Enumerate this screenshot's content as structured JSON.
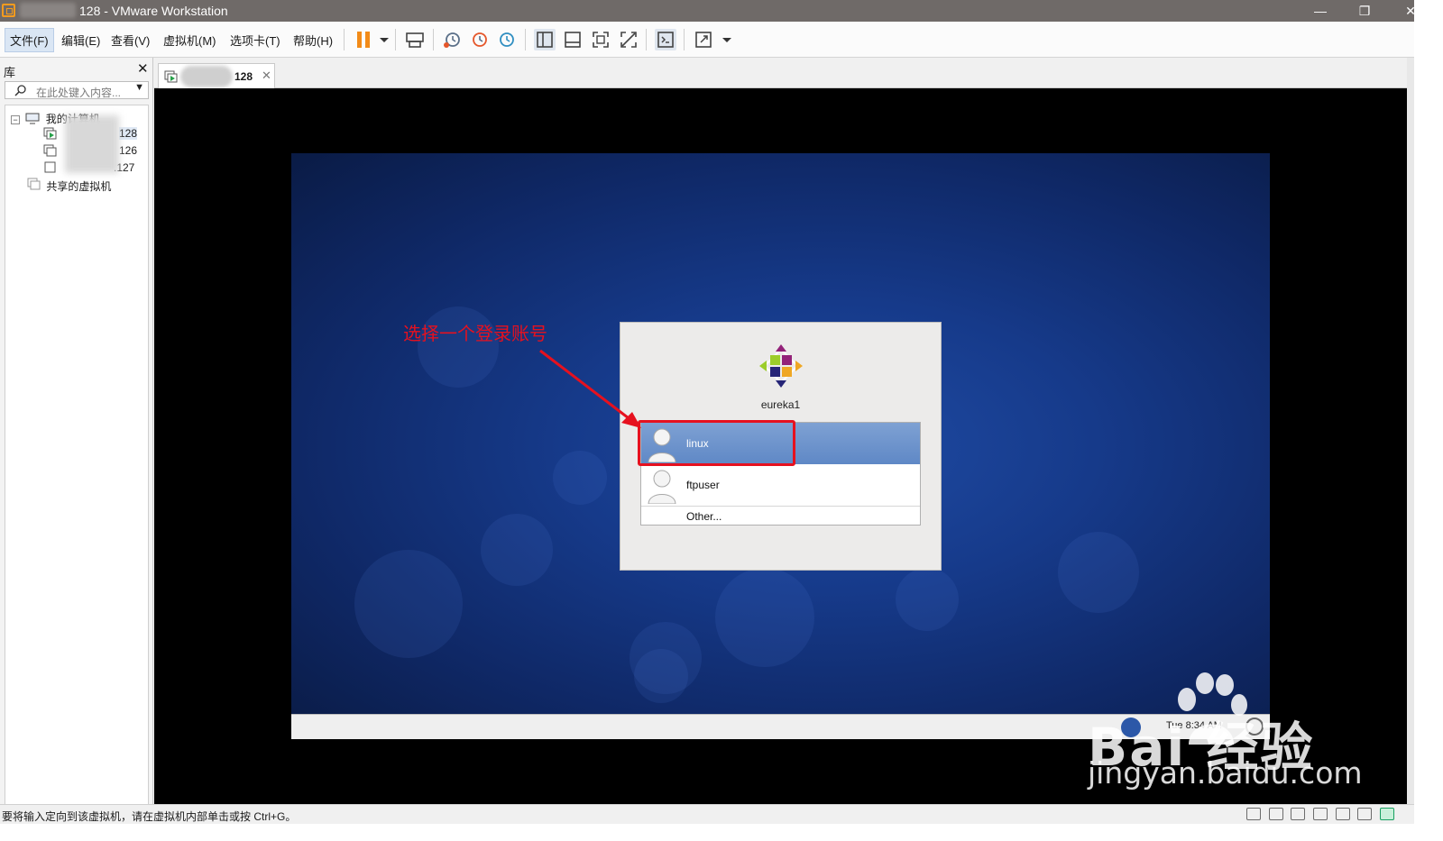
{
  "window": {
    "title": "128 - VMware Workstation"
  },
  "menu": {
    "file": "文件(F)",
    "edit": "编辑(E)",
    "view": "查看(V)",
    "vm": "虚拟机(M)",
    "tabs": "选项卡(T)",
    "help": "帮助(H)"
  },
  "library": {
    "title": "库",
    "search_placeholder": "在此处键入内容...",
    "root": "我的计算机",
    "vms": [
      "128",
      "126",
      ".127"
    ],
    "shared": "共享的虚拟机"
  },
  "tab": {
    "label": "128"
  },
  "guest": {
    "hostname": "eureka1",
    "users": [
      "linux",
      "ftpuser"
    ],
    "other": "Other...",
    "clock": "Tue  8:34 AM"
  },
  "annotation": {
    "text": "选择一个登录账号",
    "color": "#e6111f"
  },
  "watermark": {
    "brand": "Bai 经验",
    "url": "jingyan.baidu.com"
  },
  "statusbar": {
    "message": "要将输入定向到该虚拟机，请在虚拟机内部单击或按 Ctrl+G。"
  },
  "colors": {
    "accent": "#f49b1e",
    "selection": "#6a91cb",
    "titlebar": "#6f6a68"
  }
}
